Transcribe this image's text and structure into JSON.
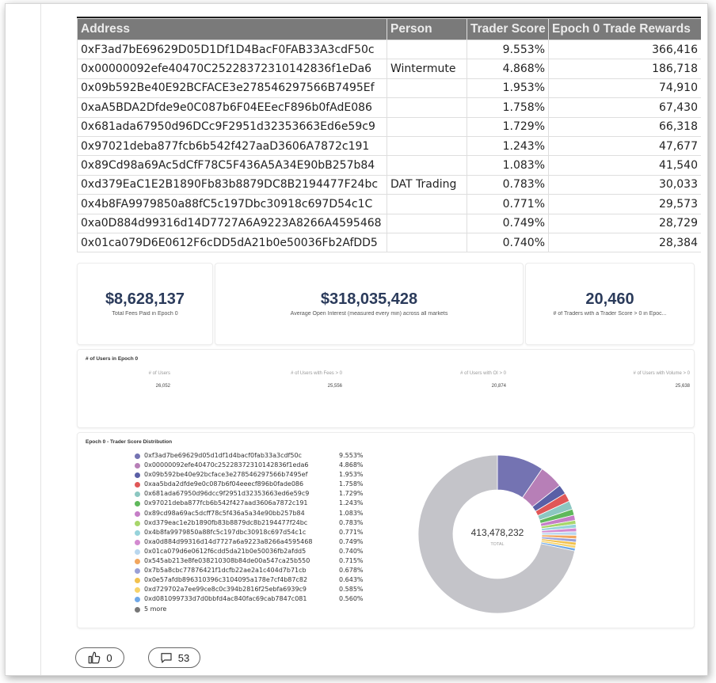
{
  "table": {
    "headers": [
      "Address",
      "Person",
      "Trader Score",
      "Epoch 0 Trade Rewards"
    ],
    "rows": [
      {
        "address": "0xF3ad7bE69629D05D1Df1D4BacF0FAB33A3cdF50c",
        "person": "",
        "score": "9.553%",
        "rewards": "366,416"
      },
      {
        "address": "0x00000092efe40470C25228372310142836f1eDa6",
        "person": "Wintermute",
        "score": "4.868%",
        "rewards": "186,718"
      },
      {
        "address": "0x09b592Be40E92BCFACE3e278546297566B7495Ef",
        "person": "",
        "score": "1.953%",
        "rewards": "74,910"
      },
      {
        "address": "0xaA5BDA2Dfde9e0C087b6F04EEecF896b0fAdE086",
        "person": "",
        "score": "1.758%",
        "rewards": "67,430"
      },
      {
        "address": "0x681ada67950d96DCc9F2951d32353663Ed6e59c9",
        "person": "",
        "score": "1.729%",
        "rewards": "66,318"
      },
      {
        "address": "0x97021deba877fcb6b542f427aaD3606A7872c191",
        "person": "",
        "score": "1.243%",
        "rewards": "47,677"
      },
      {
        "address": "0x89Cd98a69Ac5dCfF78C5F436A5A34E90bB257b84",
        "person": "",
        "score": "1.083%",
        "rewards": "41,540"
      },
      {
        "address": "0xd379EaC1E2B1890Fb83b8879DC8B2194477F24bc",
        "person": "DAT Trading",
        "score": "0.783%",
        "rewards": "30,033"
      },
      {
        "address": "0x4b8FA9979850a88fC5c197Dbc30918c697D54c1C",
        "person": "",
        "score": "0.771%",
        "rewards": "29,573"
      },
      {
        "address": "0xa0D884d99316d14D7727A6A9223A8266A4595468",
        "person": "",
        "score": "0.749%",
        "rewards": "28,729"
      },
      {
        "address": "0x01ca079D6E0612F6cDD5dA21b0e50036Fb2AfDD5",
        "person": "",
        "score": "0.740%",
        "rewards": "28,384"
      }
    ]
  },
  "stats": [
    {
      "value": "$8,628,137",
      "label": "Total Fees Paid in Epoch 0"
    },
    {
      "value": "$318,035,428",
      "label": "Average Open Interest (measured every min) across all markets"
    },
    {
      "value": "20,460",
      "label": "# of Traders with a Trader Score > 0 in Epoc..."
    }
  ],
  "users": {
    "title": "# of Users in Epoch 0",
    "cols": [
      {
        "header": "# of Users",
        "value": "26,052"
      },
      {
        "header": "# of Users with Fees > 0",
        "value": "25,556"
      },
      {
        "header": "# of Users with OI > 0",
        "value": "20,874"
      },
      {
        "header": "# of Users with Volume > 0",
        "value": "25,638"
      }
    ]
  },
  "distribution": {
    "title": "Epoch 0 - Trader Score Distribution",
    "total_value": "413,478,232",
    "total_label": "TOTAL",
    "more_label": "5 more",
    "others_color": "#c4c4c9",
    "entries": [
      {
        "address": "0xf3ad7be69629d05d1df1d4bacf0fab33a3cdf50c",
        "pct": "9.553%",
        "value": 9.553,
        "color": "#7473b2"
      },
      {
        "address": "0x00000092efe40470c25228372310142836f1eda6",
        "pct": "4.868%",
        "value": 4.868,
        "color": "#b77fb7"
      },
      {
        "address": "0x09b592be40e92bcface3e278546297566b7495ef",
        "pct": "1.953%",
        "value": 1.953,
        "color": "#5a5fa6"
      },
      {
        "address": "0xaa5bda2dfde9e0c087b6f04eeecf896b0fade086",
        "pct": "1.758%",
        "value": 1.758,
        "color": "#e05757"
      },
      {
        "address": "0x681ada67950d96dcc9f2951d32353663ed6e59c9",
        "pct": "1.729%",
        "value": 1.729,
        "color": "#8cc7c1"
      },
      {
        "address": "0x97021deba877fcb6b542f427aad3606a7872c191",
        "pct": "1.243%",
        "value": 1.243,
        "color": "#5fb85b"
      },
      {
        "address": "0x89cd98a69ac5dcff78c5f436a5a34e90bb257b84",
        "pct": "1.083%",
        "value": 1.083,
        "color": "#c57ec7"
      },
      {
        "address": "0xd379eac1e2b1890fb83b8879dc8b2194477f24bc",
        "pct": "0.783%",
        "value": 0.783,
        "color": "#a8d66b"
      },
      {
        "address": "0x4b8fa9979850a88fc5c197dbc30918c697d54c1c",
        "pct": "0.771%",
        "value": 0.771,
        "color": "#97d3db"
      },
      {
        "address": "0xa0d884d99316d14d7727a6a9223a8266a4595468",
        "pct": "0.749%",
        "value": 0.749,
        "color": "#d38ad0"
      },
      {
        "address": "0x01ca079d6e0612f6cdd5da21b0e50036fb2afdd5",
        "pct": "0.740%",
        "value": 0.74,
        "color": "#b9d7ef"
      },
      {
        "address": "0x545ab213e8fe038210308b84de00a547ca25b550",
        "pct": "0.715%",
        "value": 0.715,
        "color": "#f2a65e"
      },
      {
        "address": "0x7b5a8cbc77876421f1dcfb22ae2a1c404d7b71cb",
        "pct": "0.678%",
        "value": 0.678,
        "color": "#9aa0d6"
      },
      {
        "address": "0x0e57afdb896310396c3104095a178e7cf4b87c82",
        "pct": "0.643%",
        "value": 0.643,
        "color": "#f2c14e"
      },
      {
        "address": "0xd729702a7ee99ce8c0c394b2816f25ebfa6939c9",
        "pct": "0.585%",
        "value": 0.585,
        "color": "#f7d36a"
      },
      {
        "address": "0xd081099733d7d0bbfd4ac840fac69cab7847c081",
        "pct": "0.560%",
        "value": 0.56,
        "color": "#6fa8e8"
      }
    ]
  },
  "footer": {
    "likes": "0",
    "comments": "53"
  }
}
